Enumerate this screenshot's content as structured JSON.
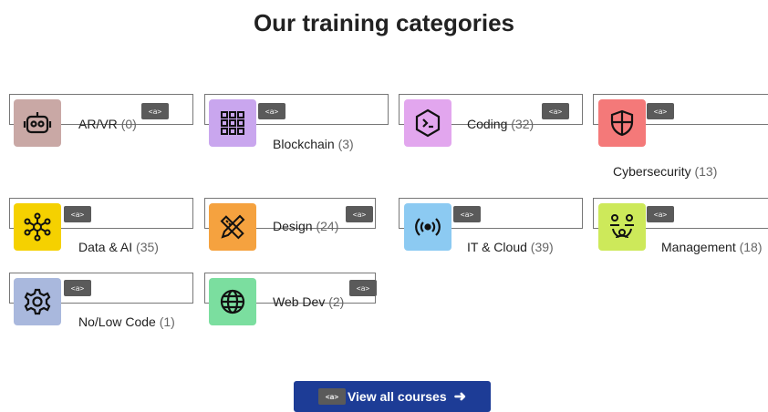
{
  "heading": "Our training categories",
  "badge_text": "<a>",
  "categories": [
    {
      "name": "AR/VR",
      "count": "(0)",
      "icon": "robot-face-icon",
      "color": "#c9a8a5"
    },
    {
      "name": "Blockchain",
      "count": "(3)",
      "icon": "blockchain-grid-icon",
      "color": "#c9a6ee"
    },
    {
      "name": "Coding",
      "count": "(32)",
      "icon": "terminal-prompt-icon",
      "color": "#e2a6ee"
    },
    {
      "name": "Cybersecurity",
      "count": "(13)",
      "icon": "shield-icon",
      "color": "#f47979"
    },
    {
      "name": "Data & AI",
      "count": "(35)",
      "icon": "network-nodes-icon",
      "color": "#f5d100"
    },
    {
      "name": "Design",
      "count": "(24)",
      "icon": "ruler-pencil-icon",
      "color": "#f5a23f"
    },
    {
      "name": "IT & Cloud",
      "count": "(39)",
      "icon": "broadcast-signal-icon",
      "color": "#8ccaf2"
    },
    {
      "name": "Management",
      "count": "(18)",
      "icon": "team-hierarchy-icon",
      "color": "#cde95a"
    },
    {
      "name": "No/Low Code",
      "count": "(1)",
      "icon": "gear-icon",
      "color": "#a9b8dd"
    },
    {
      "name": "Web Dev",
      "count": "(2)",
      "icon": "globe-icon",
      "color": "#7bde9f"
    }
  ],
  "cta": {
    "label": "View all courses",
    "arrow": "➜"
  }
}
